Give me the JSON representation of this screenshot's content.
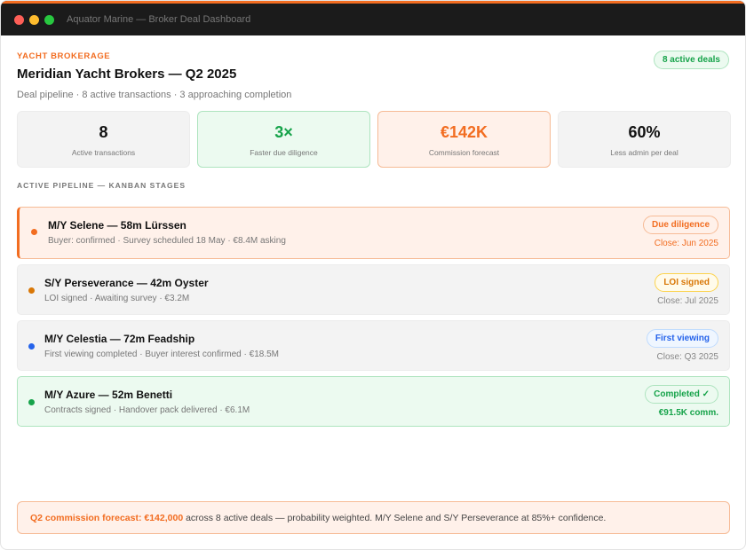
{
  "window": {
    "title": "Aquator Marine — Broker Deal Dashboard"
  },
  "header": {
    "eyebrow": "YACHT BROKERAGE",
    "title": "Meridian Yacht Brokers — Q2 2025",
    "subtitle": "Deal pipeline · 8 active transactions · 3 approaching completion",
    "badge": "8 active deals"
  },
  "stats": [
    {
      "value": "8",
      "label": "Active transactions"
    },
    {
      "value": "3×",
      "label": "Faster due diligence"
    },
    {
      "value": "€142K",
      "label": "Commission forecast"
    },
    {
      "value": "60%",
      "label": "Less admin per deal"
    }
  ],
  "pipeline": {
    "label": "ACTIVE PIPELINE — KANBAN STAGES",
    "deals": [
      {
        "name": "M/Y Selene — 58m Lürssen",
        "meta": "Buyer: confirmed · Survey scheduled 18 May · €8.4M asking",
        "badge": "Due diligence",
        "close": "Close: Jun 2025",
        "dot_color": "#f26d21",
        "badge_bg": "#fff1ea",
        "badge_border": "#f6bb96",
        "badge_color": "#f26d21"
      },
      {
        "name": "S/Y Perseverance — 42m Oyster",
        "meta": "LOI signed · Awaiting survey · €3.2M",
        "badge": "LOI signed",
        "close": "Close: Jul 2025",
        "dot_color": "#d97706",
        "badge_bg": "#fffbeb",
        "badge_border": "#fcd34d",
        "badge_color": "#d97706"
      },
      {
        "name": "M/Y Celestia — 72m Feadship",
        "meta": "First viewing completed · Buyer interest confirmed · €18.5M",
        "badge": "First viewing",
        "close": "Close: Q3 2025",
        "dot_color": "#2563eb",
        "badge_bg": "#eff6ff",
        "badge_border": "#bfdbfe",
        "badge_color": "#2563eb"
      },
      {
        "name": "M/Y Azure — 52m Benetti",
        "meta": "Contracts signed · Handover pack delivered · €6.1M",
        "badge": "Completed ✓",
        "close": "€91.5K comm.",
        "dot_color": "#16a34a",
        "badge_bg": "#ecfaf0",
        "badge_border": "#aee4bf",
        "badge_color": "#16a34a"
      }
    ]
  },
  "footer": {
    "strong": "Q2 commission forecast: €142,000",
    "text": " across 8 active deals — probability weighted. M/Y Selene and S/Y Perseverance at 85%+ confidence."
  }
}
